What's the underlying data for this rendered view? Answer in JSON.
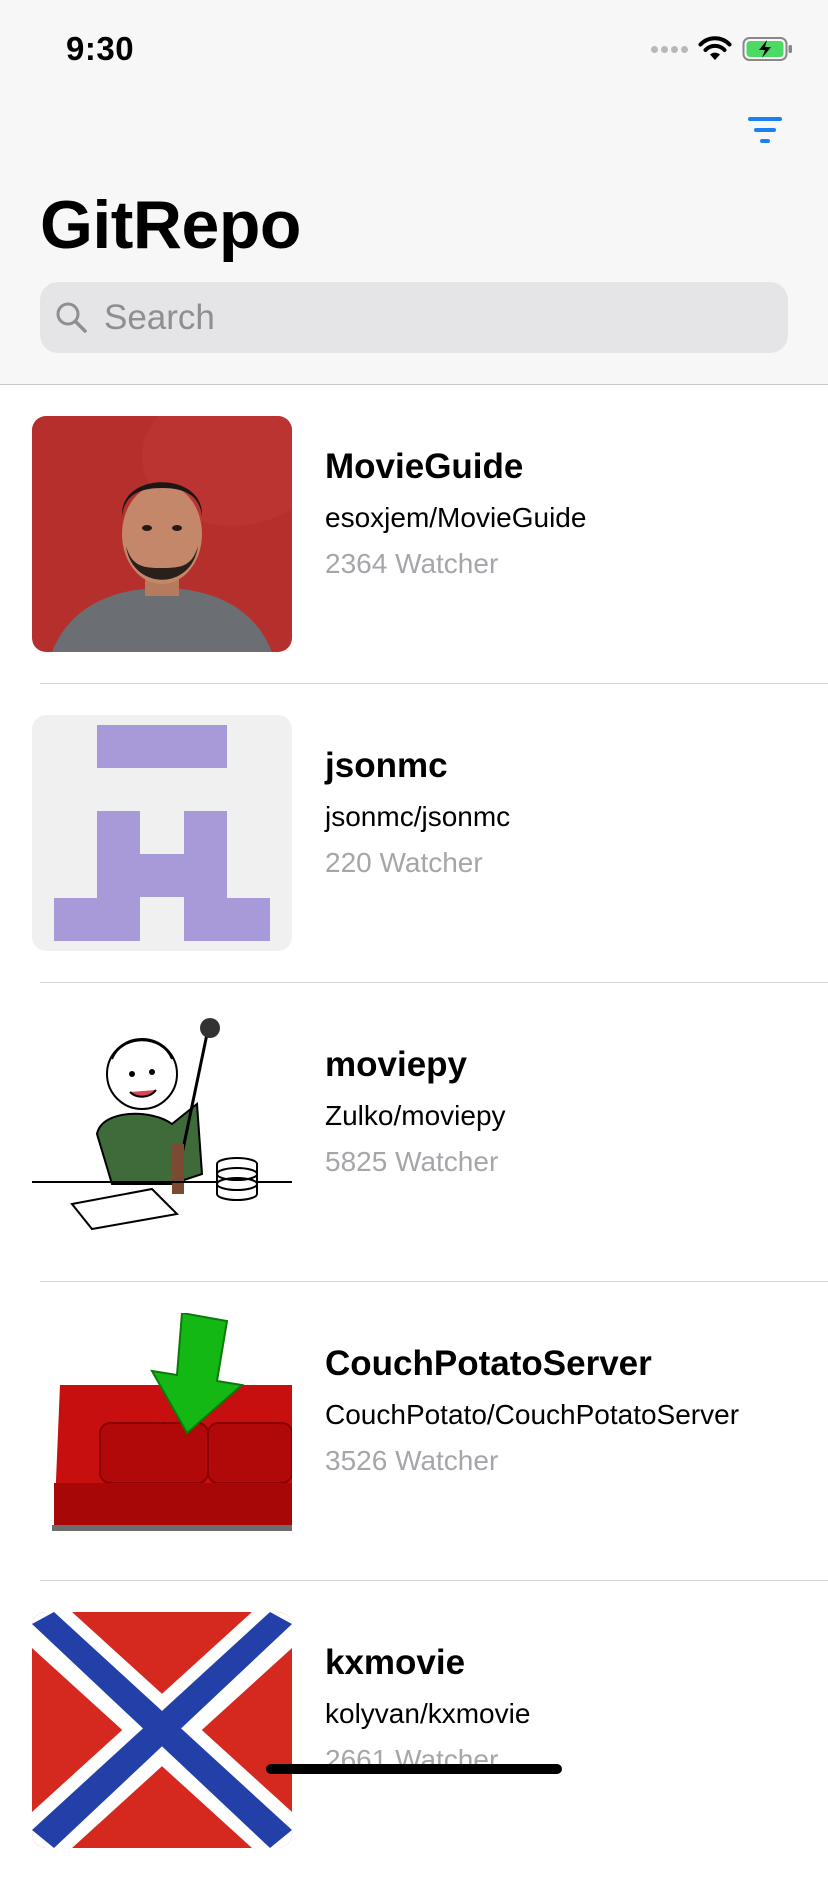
{
  "status_bar": {
    "time": "9:30"
  },
  "nav": {
    "title": "GitRepo",
    "filter_icon": "filter-icon"
  },
  "search": {
    "placeholder": "Search",
    "value": ""
  },
  "repos": [
    {
      "name": "MovieGuide",
      "full_name": "esoxjem/MovieGuide",
      "watchers": "2364 Watcher",
      "avatar": "portrait-avatar"
    },
    {
      "name": "jsonmc",
      "full_name": "jsonmc/jsonmc",
      "watchers": "220 Watcher",
      "avatar": "identicon-avatar"
    },
    {
      "name": "moviepy",
      "full_name": "Zulko/moviepy",
      "watchers": "5825 Watcher",
      "avatar": "cartoon-avatar"
    },
    {
      "name": "CouchPotatoServer",
      "full_name": "CouchPotato/CouchPotatoServer",
      "watchers": "3526 Watcher",
      "avatar": "couch-avatar"
    },
    {
      "name": "kxmovie",
      "full_name": "kolyvan/kxmovie",
      "watchers": "2661 Watcher",
      "avatar": "flag-avatar"
    }
  ],
  "colors": {
    "accent": "#1a82f0",
    "secondary_text": "#a6a6aa",
    "header_bg": "#f7f7f7"
  }
}
